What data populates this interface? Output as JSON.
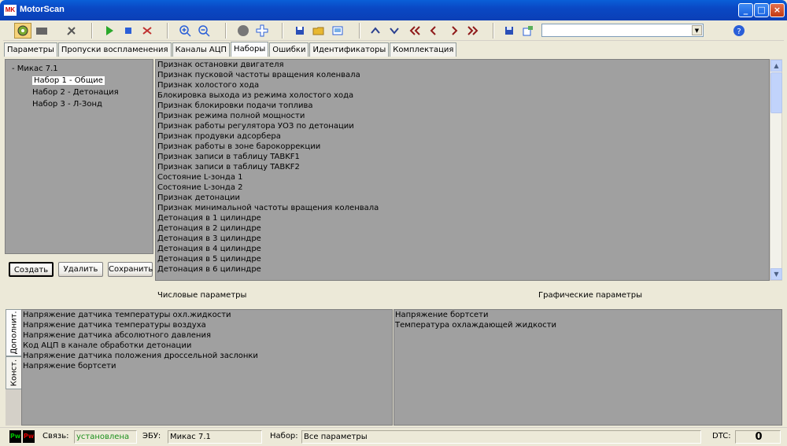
{
  "window": {
    "title": "MotorScan",
    "logo_text": "MK"
  },
  "toolbar": {
    "combo_value": ""
  },
  "tabs": [
    "Параметры",
    "Пропуски воспламенения",
    "Каналы АЦП",
    "Наборы",
    "Ошибки",
    "Идентификаторы",
    "Комплектация"
  ],
  "active_tab": "Наборы",
  "tree": {
    "root": "-  Микас 7.1",
    "nodes": [
      "Набор 1 - Общие",
      "Набор 2 - Детонация",
      "Набор 3 - Л-Зонд"
    ]
  },
  "buttons": {
    "create": "Создать",
    "delete": "Удалить",
    "save": "Сохранить"
  },
  "param_list": [
    "Признак остановки двигателя",
    "Признак пусковой частоты вращения коленвала",
    "Признак холостого хода",
    "Блокировка выхода из режима холостого хода",
    "Признак блокировки подачи топлива",
    "Признак режима полной мощности",
    "Признак работы регулятора УОЗ по детонации",
    "Признак продувки адсорбера",
    "Признак работы в зоне барокоррекции",
    "Признак записи в таблицу TABKF1",
    "Признак записи в таблицу TABKF2",
    "Состояние L-зонда 1",
    "Состояние L-зонда 2",
    "Признак детонации",
    "Признак минимальной частоты вращения коленвала",
    "Детонация в 1 цилиндре",
    "Детонация в 2 цилиндре",
    "Детонация в 3 цилиндре",
    "Детонация в 4 цилиндре",
    "Детонация в 5 цилиндре",
    "Детонация в 6 цилиндре"
  ],
  "headers": {
    "numeric": "Числовые параметры",
    "graphic": "Графические параметры"
  },
  "side_tabs": {
    "extra": "Дополнит.",
    "const": "Конст."
  },
  "numeric_params": [
    "Напряжение датчика температуры охл.жидкости",
    "Напряжение датчика температуры воздуха",
    "Напряжение датчика абсолютного давления",
    "Код АЦП в канале обработки детонации",
    "Напряжение датчика положения дроссельной заслонки",
    "Напряжение бортсети"
  ],
  "graphic_params": [
    "Напряжение бортсети",
    "Температура охлаждающей жидкости"
  ],
  "status": {
    "conn_label": "Связь:",
    "conn_value": "установлена",
    "ecu_label": "ЭБУ:",
    "ecu_value": "Микас 7.1",
    "set_label": "Набор:",
    "set_value": "Все параметры",
    "dtc_label": "DTC:",
    "dtc_value": "0",
    "pw_left": "Pw",
    "pw_right": "Pw"
  },
  "colors": {
    "conn_ok": "#1a8f1a",
    "pw_green": "#00c000",
    "pw_red": "#e00000"
  }
}
